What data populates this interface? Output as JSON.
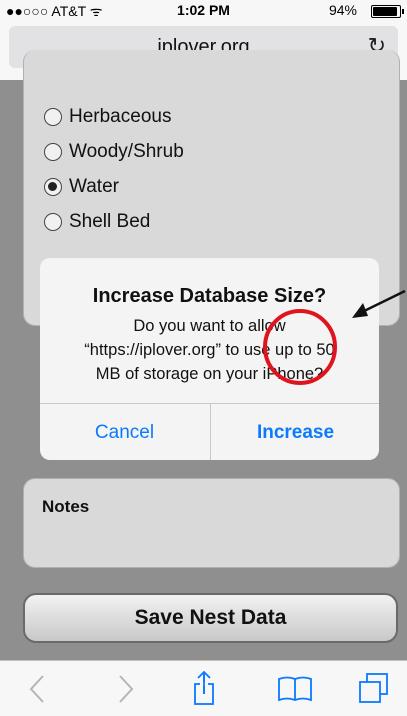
{
  "status_bar": {
    "carrier": "●●○○○ AT&T ᯤ",
    "time": "1:02 PM",
    "battery": "94%",
    "battery_level": 0.94
  },
  "browser": {
    "domain": "iplover.org",
    "reload_icon": "reload-icon"
  },
  "form": {
    "radio_options": [
      {
        "label": "Herbaceous",
        "selected": false
      },
      {
        "label": "Woody/Shrub",
        "selected": false
      },
      {
        "label": "Water",
        "selected": true
      },
      {
        "label": "Shell Bed",
        "selected": false
      }
    ],
    "notes_label": "Notes",
    "save_button": "Save Nest Data"
  },
  "dialog": {
    "title": "Increase Database Size?",
    "message": "Do you want to allow “https://iplover.org” to use up to 50 MB of storage on your iPhone?",
    "cancel": "Cancel",
    "increase": "Increase"
  },
  "toolbar": {
    "icons": [
      "back-icon",
      "forward-icon",
      "share-icon",
      "bookmarks-icon",
      "tabs-icon"
    ]
  },
  "colors": {
    "ios_blue": "#0a7aff",
    "annotation_red": "#e0141e",
    "overlay_gray": "#8f8f8f"
  }
}
